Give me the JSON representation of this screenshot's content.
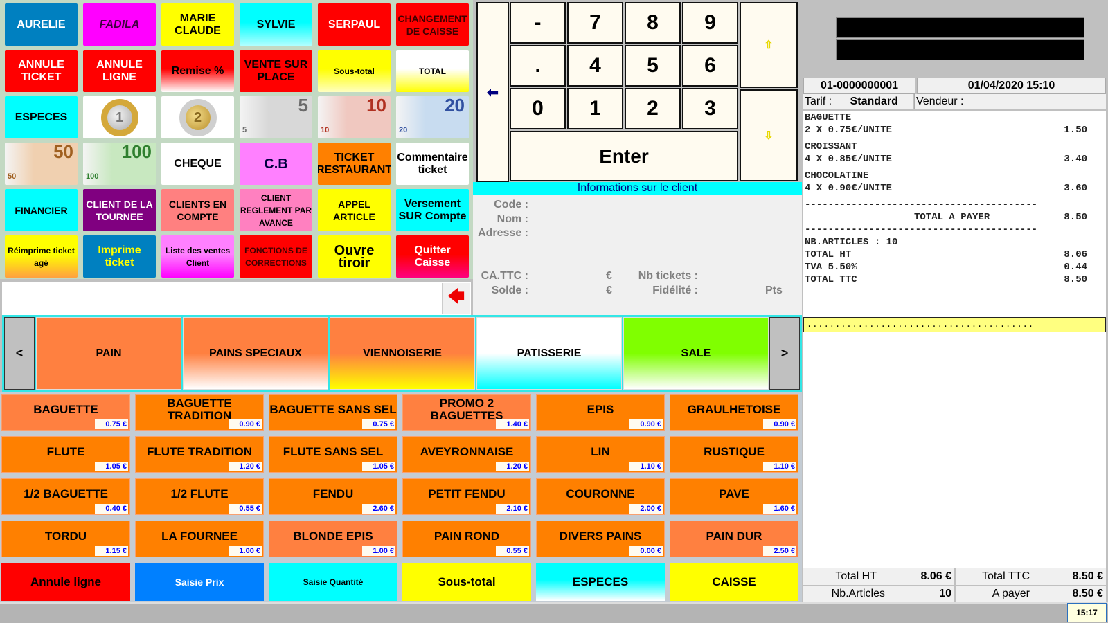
{
  "top_buttons": [
    {
      "label": "AURELIE",
      "bg": "#0080c0",
      "fg": "#ffffff"
    },
    {
      "label": "FADILA",
      "bg": "#ff00ff",
      "fg": "#400040",
      "italic": true
    },
    {
      "label": "MARIE CLAUDE",
      "bg": "#ffff00",
      "fg": "#000000"
    },
    {
      "label": "SYLVIE",
      "bg": "#00ffff",
      "bg2": "#b0ffff",
      "fg": "#000000"
    },
    {
      "label": "SERPAUL",
      "bg": "#ff0000",
      "fg": "#ffffff"
    },
    {
      "label": "CHANGEMENT DE CAISSE",
      "bg": "#ff0000",
      "fg": "#400000",
      "small": true
    },
    {
      "label": "ANNULE TICKET",
      "bg": "#ff0000",
      "fg": "#ffffff"
    },
    {
      "label": "ANNULE LIGNE",
      "bg": "#ff0000",
      "fg": "#ffffff"
    },
    {
      "label": "Remise %",
      "bg": "#ff0000",
      "bg2": "#ffffff",
      "fg": "#000000"
    },
    {
      "label": "VENTE SUR PLACE",
      "bg": "#ff0000",
      "fg": "#000000"
    },
    {
      "label": "Sous-total",
      "bg": "#ffff00",
      "bg2": "#ffffc0",
      "fg": "#000000",
      "tiny": true
    },
    {
      "label": "TOTAL",
      "bg": "#ffffff",
      "bg2": "#ffff00",
      "fg": "#000000",
      "tiny": true
    },
    {
      "label": "ESPECES",
      "bg": "#00ffff",
      "fg": "#000000"
    },
    {
      "coin": "1"
    },
    {
      "coin": "2"
    },
    {
      "note": "5",
      "bg": "#d8d8d8",
      "fg": "#6a6a6a"
    },
    {
      "note": "10",
      "bg": "#f0c8c0",
      "fg": "#b03020"
    },
    {
      "note": "20",
      "bg": "#c8dcf0",
      "fg": "#3050a0"
    },
    {
      "note": "50",
      "bg": "#f0d0b0",
      "fg": "#a06020"
    },
    {
      "note": "100",
      "bg": "#c8e8c0",
      "fg": "#308030"
    },
    {
      "label": "CHEQUE",
      "bg": "#ffffff",
      "fg": "#000000"
    },
    {
      "label": "C.B",
      "bg": "#ff80ff",
      "fg": "#000040",
      "big": true
    },
    {
      "label": "TICKET RESTAURANT",
      "bg": "#ff8000",
      "fg": "#000000"
    },
    {
      "label": "Commentaire ticket",
      "bg": "#ffffff",
      "fg": "#000000"
    },
    {
      "label": "FINANCIER",
      "bg": "#00ffff",
      "fg": "#000000",
      "small": true
    },
    {
      "label": "CLIENT DE LA TOURNEE",
      "bg": "#800080",
      "fg": "#ffffff",
      "small": true
    },
    {
      "label": "CLIENTS EN COMPTE",
      "bg": "#ff8080",
      "fg": "#000000",
      "small": true
    },
    {
      "label": "CLIENT REGLEMENT PAR AVANCE",
      "bg": "#ff80c0",
      "fg": "#000000",
      "tiny": true
    },
    {
      "label": "APPEL ARTICLE",
      "bg": "#ffff00",
      "fg": "#000000",
      "small": true
    },
    {
      "label": "Versement SUR Compte",
      "bg": "#00ffff",
      "fg": "#000000"
    },
    {
      "label": "Réimprime ticket agé",
      "bg": "#ffff00",
      "bg2": "#ffa040",
      "fg": "#000000",
      "tiny": true
    },
    {
      "label": "Imprime ticket",
      "bg": "#0080c0",
      "fg": "#ffff00"
    },
    {
      "label": "Liste des ventes Client",
      "bg": "#ff80ff",
      "bg2": "#ff00ff",
      "fg": "#000000",
      "tiny": true
    },
    {
      "label": "FONCTIONS DE CORRECTIONS",
      "bg": "#ff0000",
      "fg": "#400000",
      "tiny": true
    },
    {
      "label": "Ouvre tiroir",
      "bg": "#ffff00",
      "fg": "#000000",
      "big": true
    },
    {
      "label": "Quitter Caisse",
      "bg": "#ff0000",
      "bg2": "#ff0080",
      "fg": "#ffffff"
    }
  ],
  "input": {
    "value": ""
  },
  "keypad": {
    "keys": [
      "-",
      "7",
      "8",
      "9",
      ".",
      "4",
      "5",
      "6",
      "0",
      "1",
      "2",
      "3"
    ],
    "enter": "Enter"
  },
  "client": {
    "title": "Informations sur le client",
    "code": "Code :",
    "nom": "Nom :",
    "adresse": "Adresse :",
    "ca_ttc": "CA.TTC :",
    "solde": "Solde :",
    "euro": "€",
    "nb_tickets": "Nb tickets :",
    "fidelite": "Fidélité :",
    "pts": "Pts"
  },
  "categories": {
    "prev": "<",
    "next": ">",
    "items": [
      {
        "label": "PAIN",
        "bg": "#ff8040",
        "bg2": "#ff8040"
      },
      {
        "label": "PAINS SPECIAUX",
        "bg": "#ff8040",
        "bg2": "#ffffff"
      },
      {
        "label": "VIENNOISERIE",
        "bg": "#ff8040",
        "bg2": "#ffff00"
      },
      {
        "label": "PATISSERIE",
        "bg": "#ffffff",
        "bg2": "#00ffff"
      },
      {
        "label": "SALE",
        "bg": "#80ff00",
        "bg2": "#ffffff"
      }
    ]
  },
  "products": [
    {
      "label": "BAGUETTE",
      "price": "0.75 €",
      "light": true
    },
    {
      "label": "BAGUETTE TRADITION",
      "price": "0.90 €"
    },
    {
      "label": "BAGUETTE SANS SEL",
      "price": "0.75 €"
    },
    {
      "label": "PROMO 2 BAGUETTES",
      "price": "1.40 €",
      "light": true
    },
    {
      "label": "EPIS",
      "price": "0.90 €"
    },
    {
      "label": "GRAULHETOISE",
      "price": "0.90 €"
    },
    {
      "label": "FLUTE",
      "price": "1.05 €"
    },
    {
      "label": "FLUTE TRADITION",
      "price": "1.20 €"
    },
    {
      "label": "FLUTE SANS SEL",
      "price": "1.05 €"
    },
    {
      "label": "AVEYRONNAISE",
      "price": "1.20 €"
    },
    {
      "label": "LIN",
      "price": "1.10 €"
    },
    {
      "label": "RUSTIQUE",
      "price": "1.10 €"
    },
    {
      "label": "1/2 BAGUETTE",
      "price": "0.40 €"
    },
    {
      "label": "1/2 FLUTE",
      "price": "0.55 €"
    },
    {
      "label": "FENDU",
      "price": "2.60 €"
    },
    {
      "label": "PETIT FENDU",
      "price": "2.10 €"
    },
    {
      "label": "COURONNE",
      "price": "2.00 €"
    },
    {
      "label": "PAVE",
      "price": "1.60 €"
    },
    {
      "label": "TORDU",
      "price": "1.15 €"
    },
    {
      "label": "LA FOURNEE",
      "price": "1.00 €"
    },
    {
      "label": "BLONDE EPIS",
      "price": "1.00 €",
      "light": true
    },
    {
      "label": "PAIN ROND",
      "price": "0.55 €"
    },
    {
      "label": "DIVERS PAINS",
      "price": "0.00 €"
    },
    {
      "label": "PAIN DUR",
      "price": "2.50 €",
      "light": true
    }
  ],
  "actions": [
    {
      "label": "Annule ligne",
      "bg": "#ff0000",
      "fg": "#000000"
    },
    {
      "label": "Saisie Prix",
      "bg": "#0080ff",
      "fg": "#ffffff",
      "small": true
    },
    {
      "label": "Saisie Quantité",
      "bg": "#00ffff",
      "fg": "#000000",
      "tiny": true
    },
    {
      "label": "Sous-total",
      "bg": "#ffff00",
      "fg": "#000000"
    },
    {
      "label": "ESPECES",
      "bg": "#00ffff",
      "bg2": "#ffffff",
      "fg": "#000000"
    },
    {
      "label": "CAISSE",
      "bg": "#ffff00",
      "fg": "#000000"
    }
  ],
  "receipt": {
    "ticket_no": "01-0000000001",
    "datetime": "01/04/2020 15:10",
    "tarif_label": "Tarif :",
    "tarif": "Standard",
    "vendeur_label": "Vendeur :",
    "lines": [
      {
        "name": "BAGUETTE",
        "detail": "2 X 0.75€/UNITE",
        "amount": "1.50"
      },
      {
        "name": "CROISSANT",
        "detail": "4 X 0.85€/UNITE",
        "amount": "3.40"
      },
      {
        "name": "CHOCOLATINE",
        "detail": "4 X 0.90€/UNITE",
        "amount": "3.60"
      }
    ],
    "separator": "----------------------------------------",
    "total_label": "TOTAL A PAYER",
    "total": "8.50",
    "nb_articles": "NB.ARTICLES : 10",
    "summary": [
      {
        "label": "TOTAL HT",
        "value": "8.06"
      },
      {
        "label": "TVA 5.50%",
        "value": "0.44"
      },
      {
        "label": "TOTAL TTC",
        "value": "8.50"
      }
    ],
    "dots": "........................................"
  },
  "totals": {
    "ht_label": "Total HT",
    "ht": "8.06 €",
    "ttc_label": "Total TTC",
    "ttc": "8.50 €",
    "nb_label": "Nb.Articles",
    "nb": "10",
    "payer_label": "A payer",
    "payer": "8.50 €"
  },
  "status": {
    "clock": "15:17"
  }
}
